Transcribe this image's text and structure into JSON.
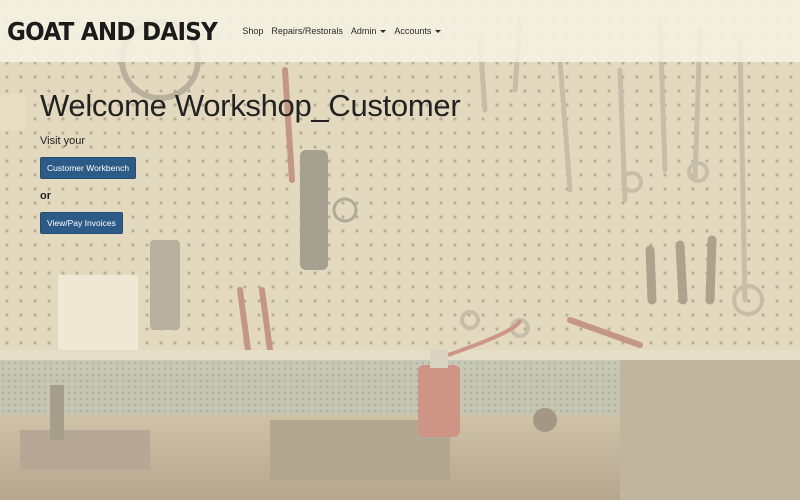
{
  "brand": {
    "name": "GOAT AND DAISY"
  },
  "nav": {
    "shop": "Shop",
    "repairs": "Repairs/Restorals",
    "admin": "Admin",
    "accounts": "Accounts"
  },
  "main": {
    "welcome": "Welcome Workshop_Customer",
    "visit_text": "Visit your",
    "workbench_button": "Customer Workbench",
    "or_text": "or",
    "invoices_button": "View/Pay Invoices"
  },
  "colors": {
    "button": "#2c5b88",
    "navbar": "#f6f2e4",
    "text": "#222222"
  },
  "icons": {
    "dropdown": "chevron-down-icon"
  }
}
